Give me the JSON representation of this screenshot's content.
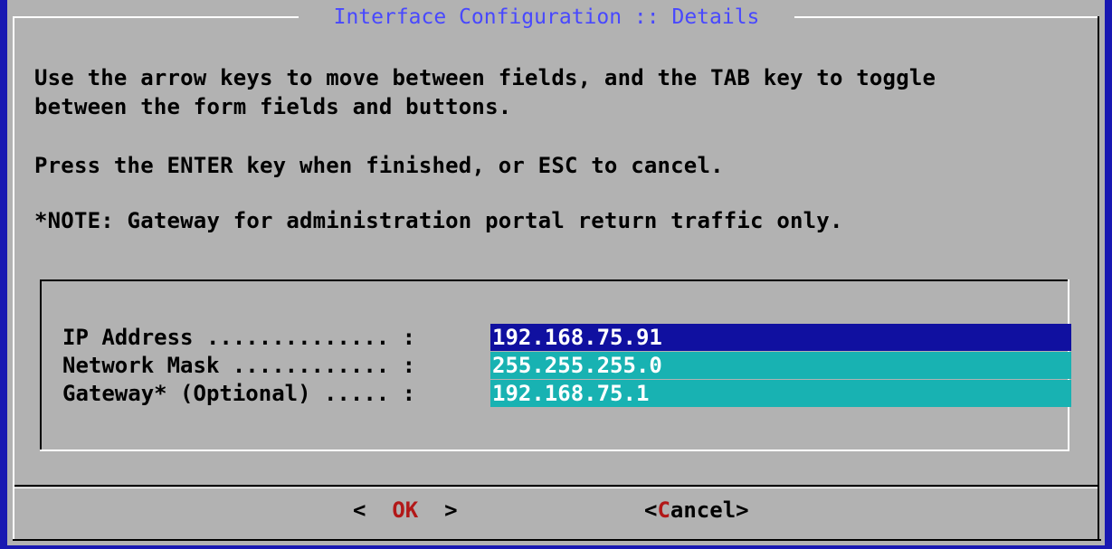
{
  "dialog": {
    "title": "Interface Configuration :: Details",
    "instructions_line1": "Use the arrow keys to move between fields, and the TAB key to toggle",
    "instructions_line2": "between the form fields and buttons.",
    "enter_hint": "Press the ENTER key when finished, or ESC to cancel.",
    "note": "*NOTE: Gateway for administration portal return traffic only."
  },
  "form": {
    "fields": [
      {
        "label": "IP Address .............. : ",
        "value": "192.168.75.91"
      },
      {
        "label": "Network Mask ............ : ",
        "value": "255.255.255.0"
      },
      {
        "label": "Gateway* (Optional) ..... : ",
        "value": "192.168.75.1"
      }
    ]
  },
  "buttons": {
    "ok_prefix": "<  ",
    "ok_hot": "OK",
    "ok_suffix": "  >",
    "cancel_prefix": "<",
    "cancel_hot": "C",
    "cancel_suffix": "ancel>"
  },
  "colors": {
    "background": "#1818b2",
    "dialog": "#b2b2b2",
    "title": "#4848ff",
    "field": "#18b2b2",
    "field_active": "#1010a0",
    "hotkey": "#b21818"
  }
}
